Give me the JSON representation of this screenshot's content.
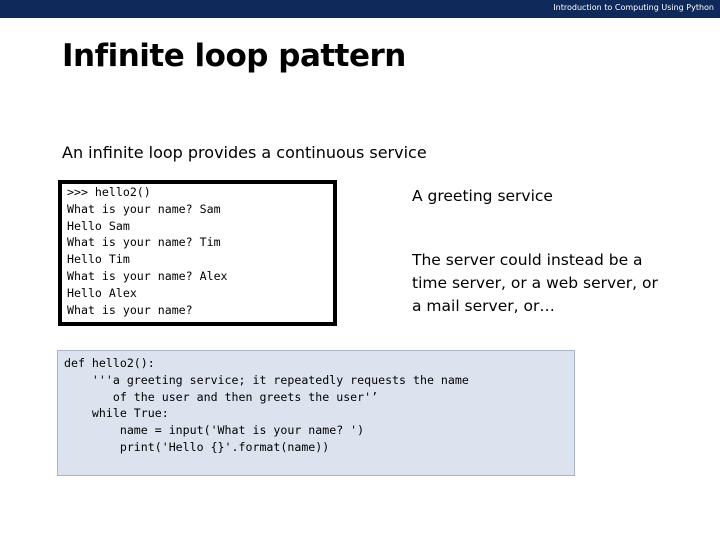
{
  "header": {
    "course_title": "Introduction to Computing Using Python"
  },
  "slide": {
    "title": "Infinite loop pattern",
    "subtitle": "An infinite loop provides a continuous service"
  },
  "console": {
    "lines": [
      ">>> hello2()",
      "What is your name? Sam",
      "Hello Sam",
      "What is your name? Tim",
      "Hello Tim",
      "What is your name? Alex",
      "Hello Alex",
      "What is your name?"
    ]
  },
  "notes": {
    "greeting": "A greeting service",
    "server": "The server could instead be a time server, or a web server, or a mail server, or…"
  },
  "code": {
    "lines": [
      "def hello2():",
      "    '''a greeting service; it repeatedly requests the name",
      "       of the user and then greets the user'’",
      "",
      "    while True:",
      "        name = input('What is your name? ')",
      "        print('Hello {}'.format(name))"
    ]
  },
  "colors": {
    "header_bar": "#0f2a5a",
    "code_background": "#dce3ee"
  }
}
